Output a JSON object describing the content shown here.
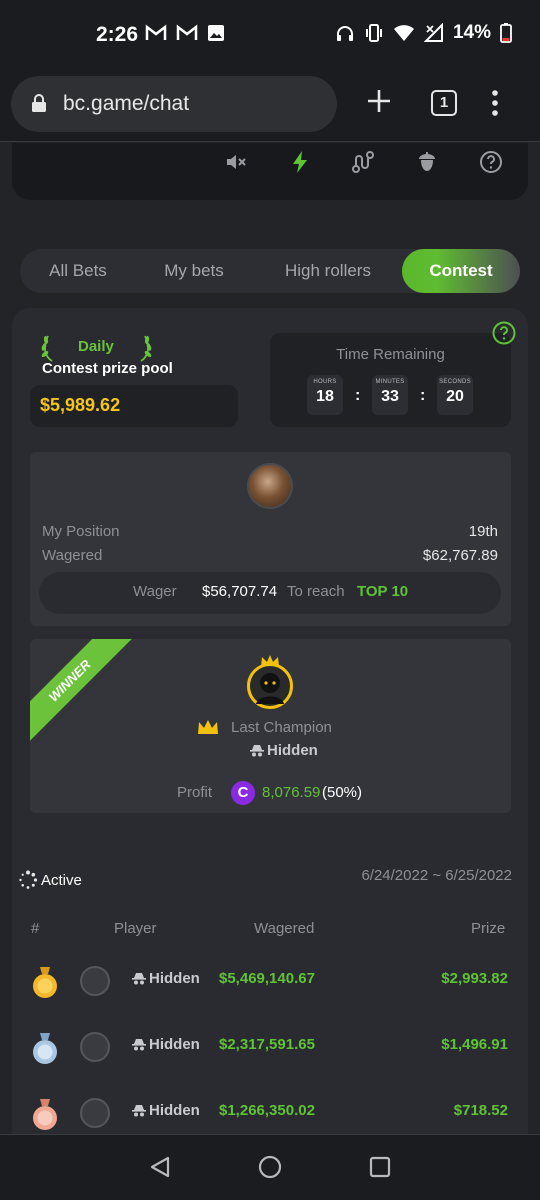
{
  "status_bar": {
    "time": "2:26",
    "battery": "14%"
  },
  "browser": {
    "url": "bc.game/chat",
    "tab_count": "1"
  },
  "toolbar_icons": [
    "mute-icon",
    "lightning-icon",
    "route-icon",
    "acorn-icon",
    "help-icon"
  ],
  "tabs": [
    {
      "label": "All Bets",
      "active": false
    },
    {
      "label": "My bets",
      "active": false
    },
    {
      "label": "High rollers",
      "active": false
    },
    {
      "label": "Contest",
      "active": true
    }
  ],
  "contest": {
    "period": "Daily",
    "pool_label": "Contest prize pool",
    "pool_amount": "$5,989.62",
    "time_remaining_label": "Time Remaining",
    "hours_label": "HOURS",
    "hours": "18",
    "minutes_label": "MINUTES",
    "minutes": "33",
    "seconds_label": "SECONDS",
    "seconds": "20",
    "colon": ":"
  },
  "my_position": {
    "position_label": "My Position",
    "position": "19th",
    "wagered_label": "Wagered",
    "wagered": "$62,767.89",
    "wager_label": "Wager",
    "wager_needed": "$56,707.74",
    "to_reach_label": "To reach",
    "target": "TOP 10"
  },
  "champion": {
    "ribbon": "WINNER",
    "label": "Last Champion",
    "name": "Hidden",
    "profit_label": "Profit",
    "coin_symbol": "C",
    "profit": "8,076.59",
    "profit_pct": "(50%)"
  },
  "leaderboard": {
    "status": "Active",
    "date_range": "6/24/2022 ~ 6/25/2022",
    "headers": {
      "rank": "#",
      "player": "Player",
      "wagered": "Wagered",
      "prize": "Prize"
    },
    "rows": [
      {
        "medal": "gold",
        "player": "Hidden",
        "wagered": "$5,469,140.67",
        "prize": "$2,993.82"
      },
      {
        "medal": "silver",
        "player": "Hidden",
        "wagered": "$2,317,591.65",
        "prize": "$1,496.91"
      },
      {
        "medal": "bronze",
        "player": "Hidden",
        "wagered": "$1,266,350.02",
        "prize": "$718.52"
      }
    ]
  },
  "colors": {
    "accent_green": "#5fc435",
    "gold": "#f5c518",
    "background": "#232428"
  }
}
